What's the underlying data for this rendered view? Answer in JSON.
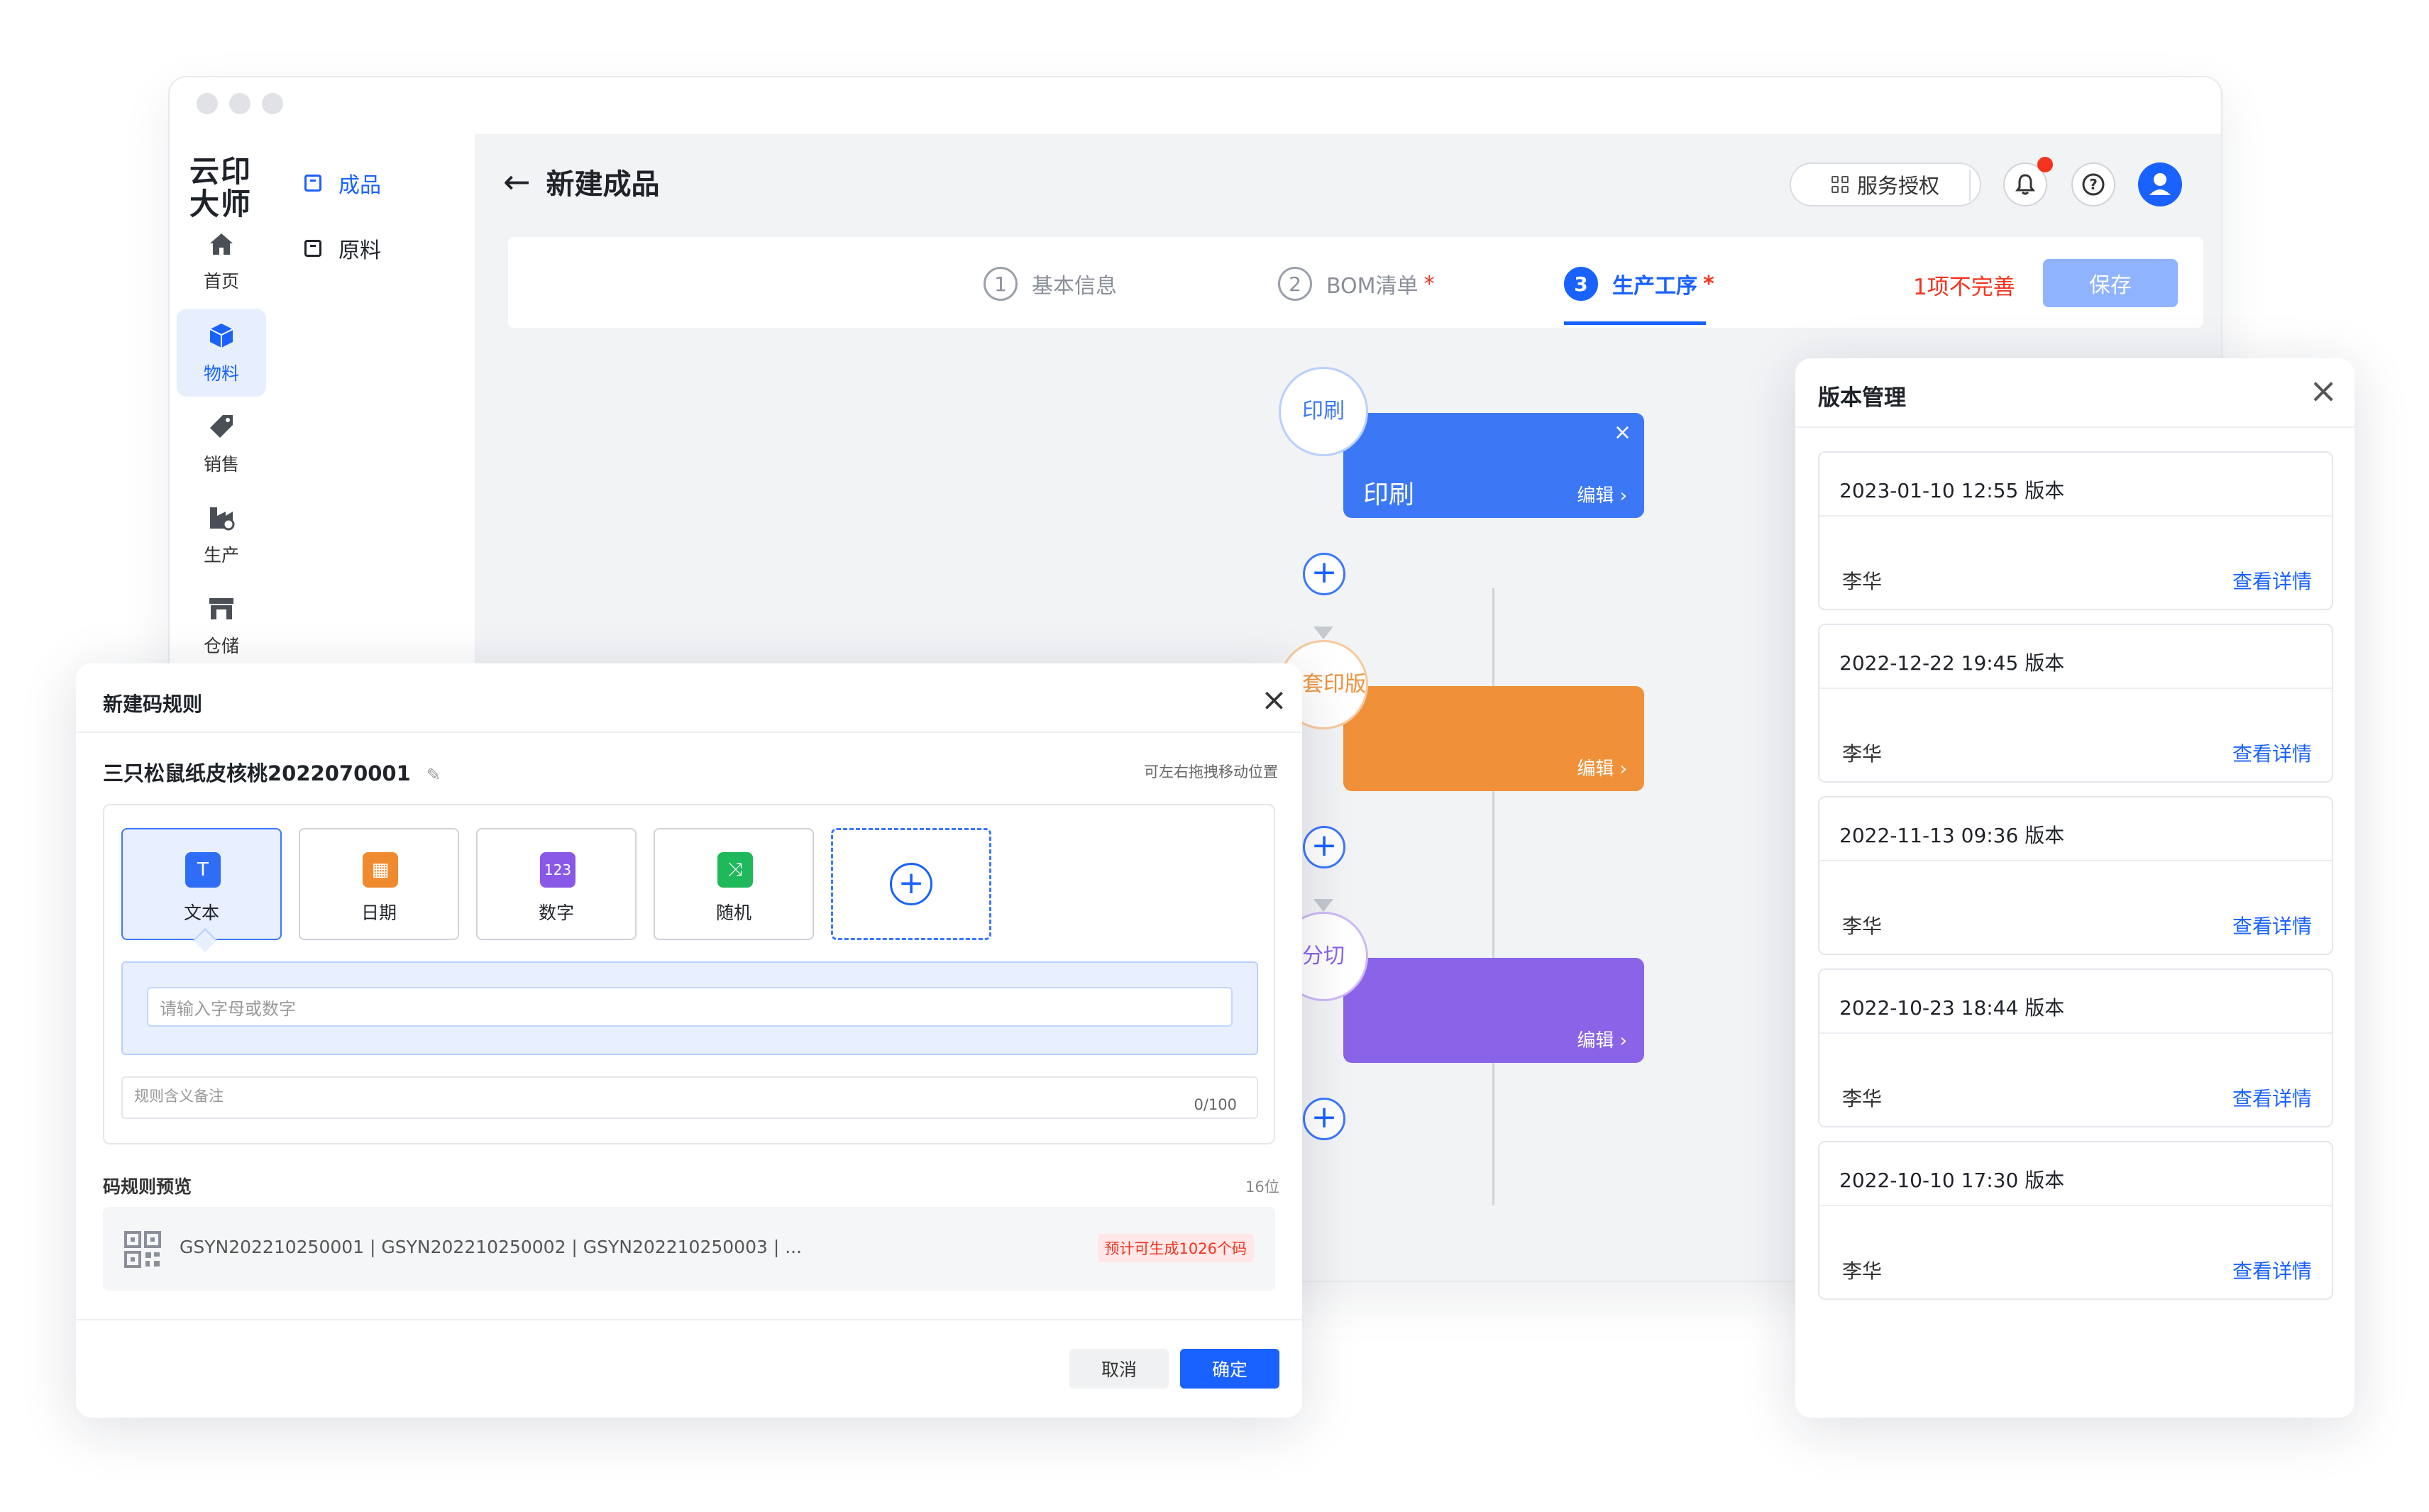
{
  "app": {
    "logo": "云印大师",
    "page_title": "新建成品",
    "back_icon": "arrow-left-icon",
    "rail": [
      {
        "label": "首页",
        "icon": "home-icon",
        "active": false
      },
      {
        "label": "物料",
        "icon": "cube-icon",
        "active": true
      },
      {
        "label": "销售",
        "icon": "tag-icon",
        "active": false
      },
      {
        "label": "生产",
        "icon": "factory-icon",
        "active": false
      },
      {
        "label": "仓储",
        "icon": "warehouse-icon",
        "active": false
      }
    ],
    "secondary_nav": [
      {
        "label": "成品",
        "active": true
      },
      {
        "label": "原料",
        "active": false
      }
    ],
    "service_button": "服务授权",
    "accent_color": "#1a62ff",
    "alert_color": "#f5331f"
  },
  "steps": {
    "items": [
      {
        "num": "1",
        "label": "基本信息",
        "required": false,
        "active": false
      },
      {
        "num": "2",
        "label": "BOM清单",
        "required": true,
        "active": false
      },
      {
        "num": "3",
        "label": "生产工序",
        "required": true,
        "active": true
      }
    ],
    "required_mark": "*",
    "incomplete_text": "1项不完善",
    "save_label": "保存"
  },
  "flow": {
    "nodes": [
      {
        "circle_label": "印刷",
        "title": "印刷",
        "edit": "编辑 ›",
        "color": "#3c78f5",
        "close": "×"
      },
      {
        "circle_label": "成套印版",
        "title": "",
        "edit": "编辑 ›",
        "color": "#f0913a"
      },
      {
        "circle_label": "分切",
        "title": "",
        "edit": "编辑 ›",
        "color": "#8a63e8"
      }
    ],
    "add_symbol": "+"
  },
  "code_dialog": {
    "title": "新建码规则",
    "name": "三只松鼠纸皮核桃2022070001",
    "edit_icon": "pencil-icon",
    "drag_hint": "可左右拖拽移动位置",
    "tiles": [
      {
        "label": "文本",
        "glyph": "T",
        "color": "#2f6df6",
        "active": true
      },
      {
        "label": "日期",
        "glyph": "▦",
        "color": "#f08a2e",
        "active": false
      },
      {
        "label": "数字",
        "glyph": "123",
        "color": "#8a58e6",
        "active": false
      },
      {
        "label": "随机",
        "glyph": "⤨",
        "color": "#1fb85a",
        "active": false
      }
    ],
    "add_tile": "+",
    "input_placeholder": "请输入字母或数字",
    "remark_placeholder": "规则含义备注",
    "remark_count": "0/100",
    "preview_title": "码规则预览",
    "preview_bits": "16位",
    "preview_codes": "GSYN202210250001 | GSYN202210250002 | GSYN202210250003 | ...",
    "estimate": "预计可生成1026个码",
    "cancel": "取消",
    "confirm": "确定"
  },
  "version_panel": {
    "title": "版本管理",
    "versions": [
      {
        "datetime": "2023-01-10 12:55  版本",
        "user": "李华",
        "link": "查看详情"
      },
      {
        "datetime": "2022-12-22 19:45  版本",
        "user": "李华",
        "link": "查看详情"
      },
      {
        "datetime": "2022-11-13 09:36  版本",
        "user": "李华",
        "link": "查看详情"
      },
      {
        "datetime": "2022-10-23 18:44  版本",
        "user": "李华",
        "link": "查看详情"
      },
      {
        "datetime": "2022-10-10 17:30  版本",
        "user": "李华",
        "link": "查看详情"
      }
    ]
  }
}
